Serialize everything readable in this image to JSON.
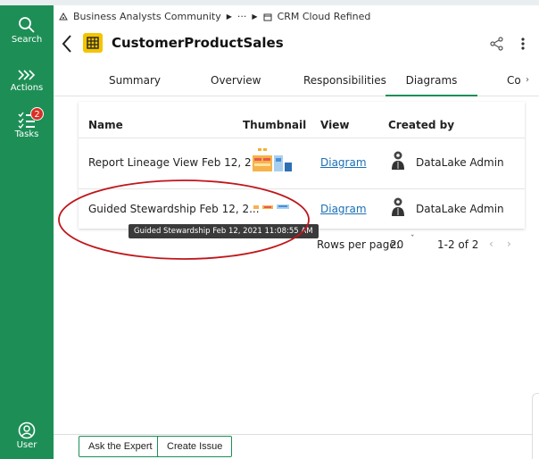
{
  "rail": {
    "search": "Search",
    "actions": "Actions",
    "tasks": "Tasks",
    "tasks_badge": "2",
    "user": "User"
  },
  "breadcrumb": {
    "community": "Business Analysts Community",
    "ellipsis": "···",
    "domain": "CRM Cloud Refined"
  },
  "header": {
    "title": "CustomerProductSales"
  },
  "tabs": [
    "Summary",
    "Overview",
    "Responsibilities",
    "Diagrams",
    "Co"
  ],
  "active_tab": "Diagrams",
  "table": {
    "headers": [
      "Name",
      "Thumbnail",
      "View",
      "Created by"
    ],
    "rows": [
      {
        "name": "Report Lineage View Feb 12, 2...",
        "view": "Diagram",
        "created_by": "DataLake Admin"
      },
      {
        "name": "Guided Stewardship Feb 12, 2...",
        "view": "Diagram",
        "created_by": "DataLake Admin"
      }
    ]
  },
  "tooltip": "Guided Stewardship Feb 12, 2021 11:08:55 AM",
  "pagination": {
    "rows_per_page_label": "Rows per page:",
    "rows_per_page": "20",
    "range": "1-2 of 2"
  },
  "footer": {
    "ask_expert": "Ask the Expert",
    "create_issue": "Create Issue"
  },
  "colors": {
    "brand_green": "#1d8f56",
    "badge_red": "#d93025",
    "link_blue": "#1a6fb5",
    "tile_yellow": "#f4c400",
    "annotation_red": "#c0161b"
  }
}
